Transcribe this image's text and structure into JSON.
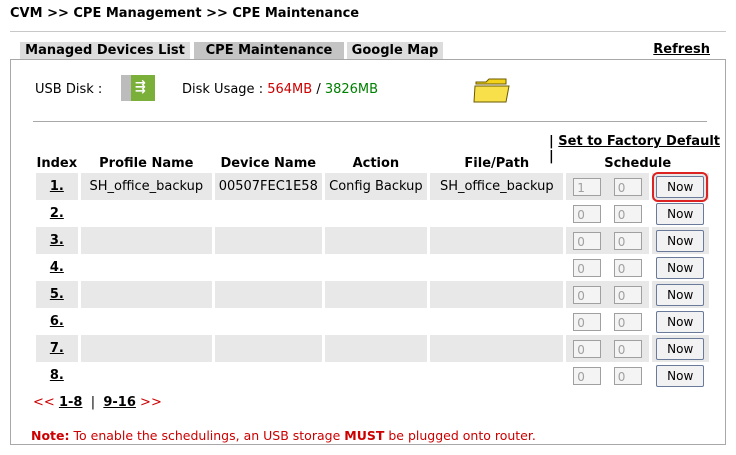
{
  "breadcrumb": "CVM >> CPE Management >> CPE Maintenance",
  "tabs": [
    {
      "label": "Managed Devices List"
    },
    {
      "label": "CPE Maintenance"
    },
    {
      "label": "Google Map"
    }
  ],
  "refresh_label": "Refresh",
  "usb": {
    "label": "USB Disk :",
    "icon": "usb-icon"
  },
  "disk": {
    "label": "Disk Usage :",
    "used": "564MB",
    "separator": "/",
    "total": "3826MB",
    "icon": "folder-icon"
  },
  "factory": {
    "prefix": "|",
    "label": "Set to Factory Default",
    "suffix": "|"
  },
  "table": {
    "headers": [
      "Index",
      "Profile Name",
      "Device Name",
      "Action",
      "File/Path",
      "Schedule"
    ],
    "rows": [
      {
        "index": "1.",
        "profile": "SH_office_backup",
        "device": "00507FEC1E58",
        "action": "Config Backup",
        "path": "SH_office_backup",
        "s1": "1",
        "s2": "0",
        "button": "Now"
      },
      {
        "index": "2.",
        "profile": "",
        "device": "",
        "action": "",
        "path": "",
        "s1": "0",
        "s2": "0",
        "button": "Now"
      },
      {
        "index": "3.",
        "profile": "",
        "device": "",
        "action": "",
        "path": "",
        "s1": "0",
        "s2": "0",
        "button": "Now"
      },
      {
        "index": "4.",
        "profile": "",
        "device": "",
        "action": "",
        "path": "",
        "s1": "0",
        "s2": "0",
        "button": "Now"
      },
      {
        "index": "5.",
        "profile": "",
        "device": "",
        "action": "",
        "path": "",
        "s1": "0",
        "s2": "0",
        "button": "Now"
      },
      {
        "index": "6.",
        "profile": "",
        "device": "",
        "action": "",
        "path": "",
        "s1": "0",
        "s2": "0",
        "button": "Now"
      },
      {
        "index": "7.",
        "profile": "",
        "device": "",
        "action": "",
        "path": "",
        "s1": "0",
        "s2": "0",
        "button": "Now"
      },
      {
        "index": "8.",
        "profile": "",
        "device": "",
        "action": "",
        "path": "",
        "s1": "0",
        "s2": "0",
        "button": "Now"
      }
    ]
  },
  "pager": {
    "prev": "<<",
    "page1": "1-8",
    "sep": "|",
    "page2": "9-16",
    "next": ">>"
  },
  "note": {
    "label": "Note:",
    "text1": "To enable the schedulings, an USB storage",
    "must": "MUST",
    "text2": "be plugged onto router."
  },
  "colors": {
    "accent_red": "#cc0000",
    "accent_green": "#008000",
    "usb_green": "#7ab03a",
    "folder_yellow": "#f2d21a"
  }
}
